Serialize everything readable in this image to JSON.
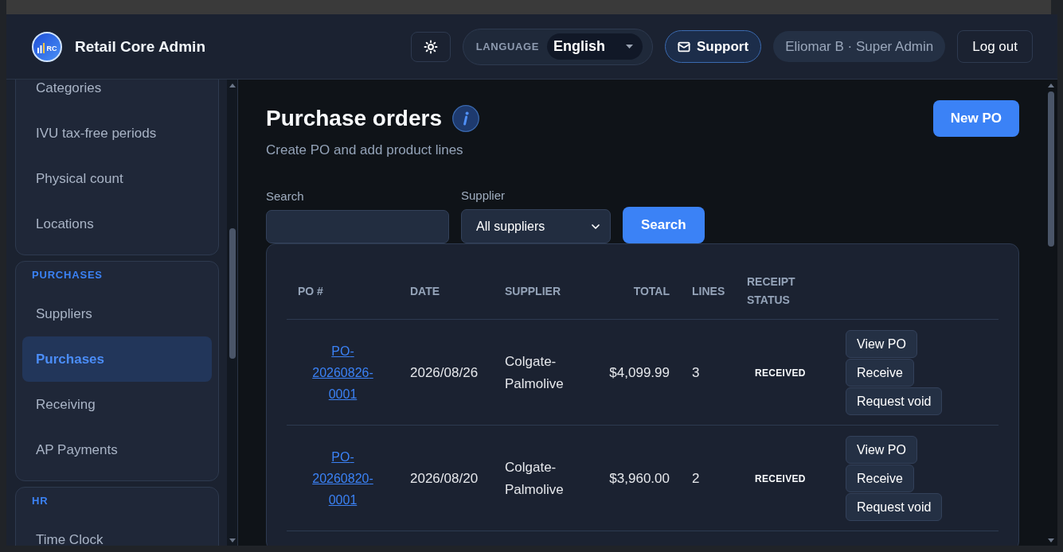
{
  "header": {
    "logo_text": "RC",
    "app_title": "Retail Core Admin",
    "language": {
      "label": "LANGUAGE",
      "value": "English"
    },
    "support_button": "Support",
    "user": "Eliomar B · Super Admin",
    "logout_button": "Log out"
  },
  "sidebar": {
    "groups": [
      {
        "items": [
          {
            "label": "Categories",
            "selected": false
          },
          {
            "label": "IVU tax-free periods",
            "selected": false
          },
          {
            "label": "Physical count",
            "selected": false
          },
          {
            "label": "Locations",
            "selected": false
          }
        ]
      },
      {
        "title": "PURCHASES",
        "items": [
          {
            "label": "Suppliers",
            "selected": false
          },
          {
            "label": "Purchases",
            "selected": true
          },
          {
            "label": "Receiving",
            "selected": false
          },
          {
            "label": "AP Payments",
            "selected": false
          }
        ]
      },
      {
        "title": "HR",
        "items": [
          {
            "label": "Time Clock",
            "selected": false
          }
        ]
      }
    ]
  },
  "page": {
    "title": "Purchase orders",
    "subtitle": "Create PO and add product lines",
    "new_button": "New PO"
  },
  "filters": {
    "search_label": "Search",
    "supplier": {
      "label": "Supplier",
      "value": "All suppliers"
    },
    "search_button": "Search"
  },
  "table": {
    "columns": [
      "PO #",
      "DATE",
      "SUPPLIER",
      "TOTAL",
      "LINES",
      "RECEIPT STATUS"
    ],
    "rows": [
      {
        "po": "PO-20260826-0001",
        "date": "2026/08/26",
        "supplier": "Colgate-Palmolive",
        "total": "$4,099.99",
        "lines": "3",
        "status": "RECEIVED",
        "actions": [
          "View PO",
          "Receive",
          "Request void"
        ]
      },
      {
        "po": "PO-20260820-0001",
        "date": "2026/08/20",
        "supplier": "Colgate-Palmolive",
        "total": "$3,960.00",
        "lines": "2",
        "status": "RECEIVED",
        "actions": [
          "View PO",
          "Receive",
          "Request void"
        ]
      }
    ]
  }
}
